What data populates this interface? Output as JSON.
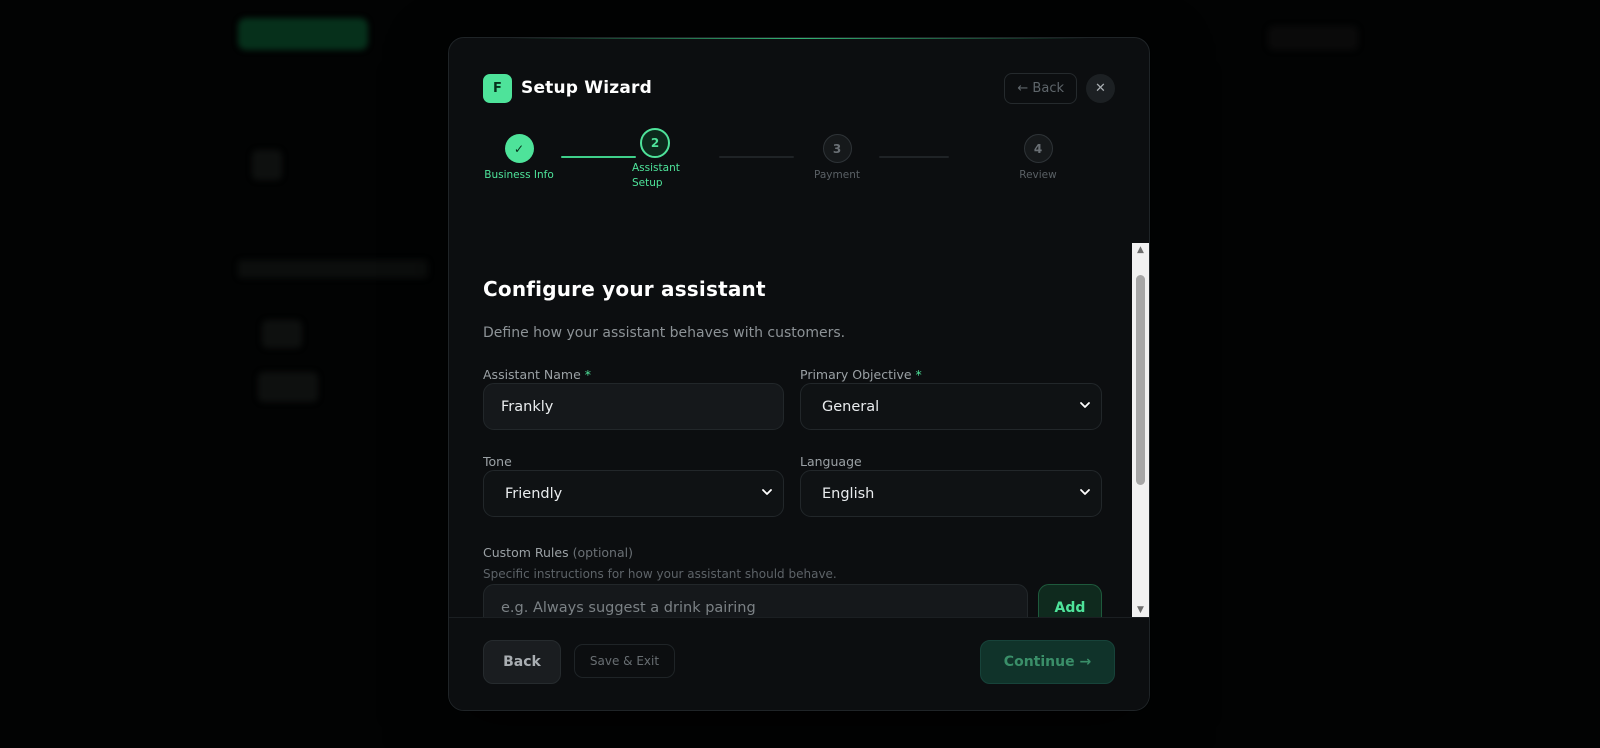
{
  "wizard": {
    "logo_letter": "F",
    "title": "Setup Wizard",
    "back_label": "← Back",
    "close_glyph": "✕"
  },
  "steps": [
    {
      "number": "✓",
      "label": "Business Info",
      "state": "done"
    },
    {
      "number": "2",
      "label": "Assistant Setup",
      "state": "active"
    },
    {
      "number": "3",
      "label": "Payment",
      "state": "pending"
    },
    {
      "number": "4",
      "label": "Review",
      "state": "pending"
    }
  ],
  "form": {
    "heading": "Configure your assistant",
    "subheading": "Define how your assistant behaves with customers.",
    "assistant_name": {
      "label": "Assistant Name",
      "required_mark": "*",
      "value": "Frankly"
    },
    "primary_objective": {
      "label": "Primary Objective",
      "required_mark": "*",
      "value": "General"
    },
    "tone": {
      "label": "Tone",
      "value": "Friendly"
    },
    "language": {
      "label": "Language",
      "value": "English"
    },
    "custom_rules": {
      "label": "Custom Rules",
      "optional": "(optional)",
      "help": "Specific instructions for how your assistant should behave.",
      "placeholder": "e.g. Always suggest a drink pairing",
      "add_label": "Add"
    }
  },
  "footer": {
    "back_label": "Back",
    "save_exit_label": "Save & Exit",
    "continue_label": "Continue →"
  },
  "colors": {
    "accent": "#4ee39a",
    "modal_bg": "#0c0e10",
    "page_bg": "#000000"
  },
  "icons": {
    "chevron": "chevron-down-icon",
    "close": "close-icon",
    "check": "check-icon"
  }
}
